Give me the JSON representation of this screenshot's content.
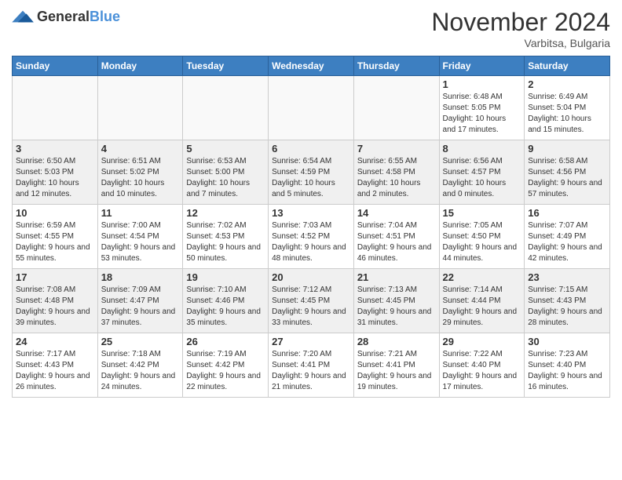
{
  "logo": {
    "general": "General",
    "blue": "Blue"
  },
  "header": {
    "month": "November 2024",
    "location": "Varbitsa, Bulgaria"
  },
  "weekdays": [
    "Sunday",
    "Monday",
    "Tuesday",
    "Wednesday",
    "Thursday",
    "Friday",
    "Saturday"
  ],
  "weeks": [
    [
      {
        "day": "",
        "info": ""
      },
      {
        "day": "",
        "info": ""
      },
      {
        "day": "",
        "info": ""
      },
      {
        "day": "",
        "info": ""
      },
      {
        "day": "",
        "info": ""
      },
      {
        "day": "1",
        "info": "Sunrise: 6:48 AM\nSunset: 5:05 PM\nDaylight: 10 hours and 17 minutes."
      },
      {
        "day": "2",
        "info": "Sunrise: 6:49 AM\nSunset: 5:04 PM\nDaylight: 10 hours and 15 minutes."
      }
    ],
    [
      {
        "day": "3",
        "info": "Sunrise: 6:50 AM\nSunset: 5:03 PM\nDaylight: 10 hours and 12 minutes."
      },
      {
        "day": "4",
        "info": "Sunrise: 6:51 AM\nSunset: 5:02 PM\nDaylight: 10 hours and 10 minutes."
      },
      {
        "day": "5",
        "info": "Sunrise: 6:53 AM\nSunset: 5:00 PM\nDaylight: 10 hours and 7 minutes."
      },
      {
        "day": "6",
        "info": "Sunrise: 6:54 AM\nSunset: 4:59 PM\nDaylight: 10 hours and 5 minutes."
      },
      {
        "day": "7",
        "info": "Sunrise: 6:55 AM\nSunset: 4:58 PM\nDaylight: 10 hours and 2 minutes."
      },
      {
        "day": "8",
        "info": "Sunrise: 6:56 AM\nSunset: 4:57 PM\nDaylight: 10 hours and 0 minutes."
      },
      {
        "day": "9",
        "info": "Sunrise: 6:58 AM\nSunset: 4:56 PM\nDaylight: 9 hours and 57 minutes."
      }
    ],
    [
      {
        "day": "10",
        "info": "Sunrise: 6:59 AM\nSunset: 4:55 PM\nDaylight: 9 hours and 55 minutes."
      },
      {
        "day": "11",
        "info": "Sunrise: 7:00 AM\nSunset: 4:54 PM\nDaylight: 9 hours and 53 minutes."
      },
      {
        "day": "12",
        "info": "Sunrise: 7:02 AM\nSunset: 4:53 PM\nDaylight: 9 hours and 50 minutes."
      },
      {
        "day": "13",
        "info": "Sunrise: 7:03 AM\nSunset: 4:52 PM\nDaylight: 9 hours and 48 minutes."
      },
      {
        "day": "14",
        "info": "Sunrise: 7:04 AM\nSunset: 4:51 PM\nDaylight: 9 hours and 46 minutes."
      },
      {
        "day": "15",
        "info": "Sunrise: 7:05 AM\nSunset: 4:50 PM\nDaylight: 9 hours and 44 minutes."
      },
      {
        "day": "16",
        "info": "Sunrise: 7:07 AM\nSunset: 4:49 PM\nDaylight: 9 hours and 42 minutes."
      }
    ],
    [
      {
        "day": "17",
        "info": "Sunrise: 7:08 AM\nSunset: 4:48 PM\nDaylight: 9 hours and 39 minutes."
      },
      {
        "day": "18",
        "info": "Sunrise: 7:09 AM\nSunset: 4:47 PM\nDaylight: 9 hours and 37 minutes."
      },
      {
        "day": "19",
        "info": "Sunrise: 7:10 AM\nSunset: 4:46 PM\nDaylight: 9 hours and 35 minutes."
      },
      {
        "day": "20",
        "info": "Sunrise: 7:12 AM\nSunset: 4:45 PM\nDaylight: 9 hours and 33 minutes."
      },
      {
        "day": "21",
        "info": "Sunrise: 7:13 AM\nSunset: 4:45 PM\nDaylight: 9 hours and 31 minutes."
      },
      {
        "day": "22",
        "info": "Sunrise: 7:14 AM\nSunset: 4:44 PM\nDaylight: 9 hours and 29 minutes."
      },
      {
        "day": "23",
        "info": "Sunrise: 7:15 AM\nSunset: 4:43 PM\nDaylight: 9 hours and 28 minutes."
      }
    ],
    [
      {
        "day": "24",
        "info": "Sunrise: 7:17 AM\nSunset: 4:43 PM\nDaylight: 9 hours and 26 minutes."
      },
      {
        "day": "25",
        "info": "Sunrise: 7:18 AM\nSunset: 4:42 PM\nDaylight: 9 hours and 24 minutes."
      },
      {
        "day": "26",
        "info": "Sunrise: 7:19 AM\nSunset: 4:42 PM\nDaylight: 9 hours and 22 minutes."
      },
      {
        "day": "27",
        "info": "Sunrise: 7:20 AM\nSunset: 4:41 PM\nDaylight: 9 hours and 21 minutes."
      },
      {
        "day": "28",
        "info": "Sunrise: 7:21 AM\nSunset: 4:41 PM\nDaylight: 9 hours and 19 minutes."
      },
      {
        "day": "29",
        "info": "Sunrise: 7:22 AM\nSunset: 4:40 PM\nDaylight: 9 hours and 17 minutes."
      },
      {
        "day": "30",
        "info": "Sunrise: 7:23 AM\nSunset: 4:40 PM\nDaylight: 9 hours and 16 minutes."
      }
    ]
  ]
}
